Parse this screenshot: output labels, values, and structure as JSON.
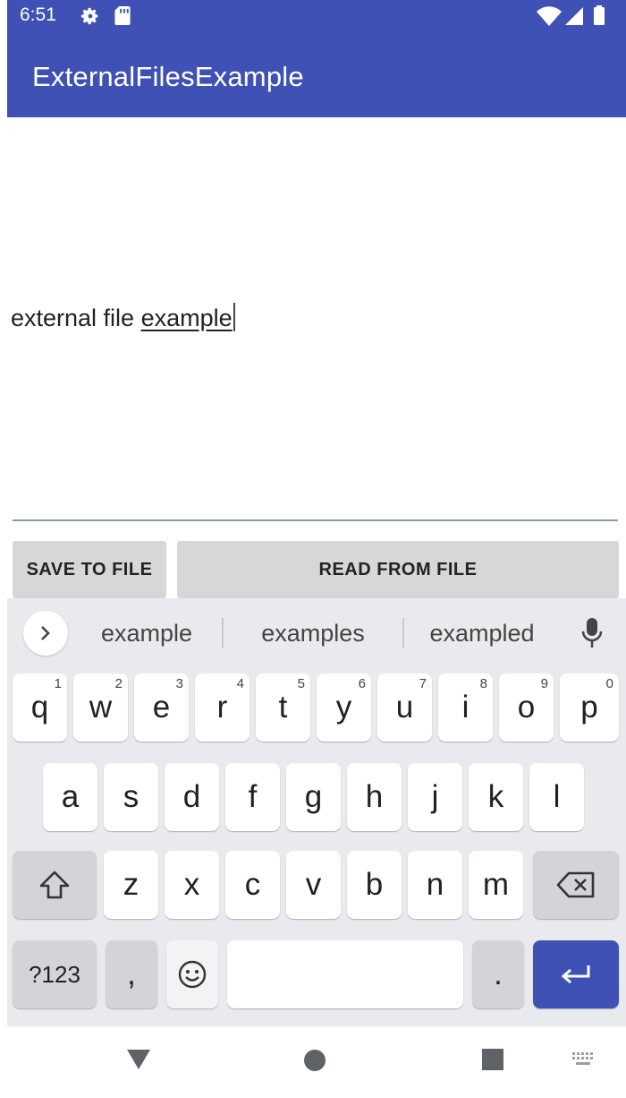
{
  "status_bar": {
    "time": "6:51",
    "icons": [
      "gear-icon",
      "sd-card-icon",
      "wifi-icon",
      "signal-icon",
      "battery-icon"
    ]
  },
  "app_bar": {
    "title": "ExternalFilesExample"
  },
  "edit_text": {
    "text_plain": "external file ",
    "text_composing": "example"
  },
  "buttons": {
    "save": "SAVE TO FILE",
    "read": "READ FROM FILE"
  },
  "keyboard": {
    "suggestions": [
      "example",
      "examples",
      "exampled"
    ],
    "row1": [
      {
        "key": "q",
        "hint": "1"
      },
      {
        "key": "w",
        "hint": "2"
      },
      {
        "key": "e",
        "hint": "3"
      },
      {
        "key": "r",
        "hint": "4"
      },
      {
        "key": "t",
        "hint": "5"
      },
      {
        "key": "y",
        "hint": "6"
      },
      {
        "key": "u",
        "hint": "7"
      },
      {
        "key": "i",
        "hint": "8"
      },
      {
        "key": "o",
        "hint": "9"
      },
      {
        "key": "p",
        "hint": "0"
      }
    ],
    "row2": [
      "a",
      "s",
      "d",
      "f",
      "g",
      "h",
      "j",
      "k",
      "l"
    ],
    "row3": [
      "z",
      "x",
      "c",
      "v",
      "b",
      "n",
      "m"
    ],
    "symbols_label": "?123",
    "comma": ",",
    "period": "."
  },
  "colors": {
    "primary": "#3f51b5",
    "keyboard_bg": "#e8eaed",
    "button_bg": "#d6d7d7"
  }
}
